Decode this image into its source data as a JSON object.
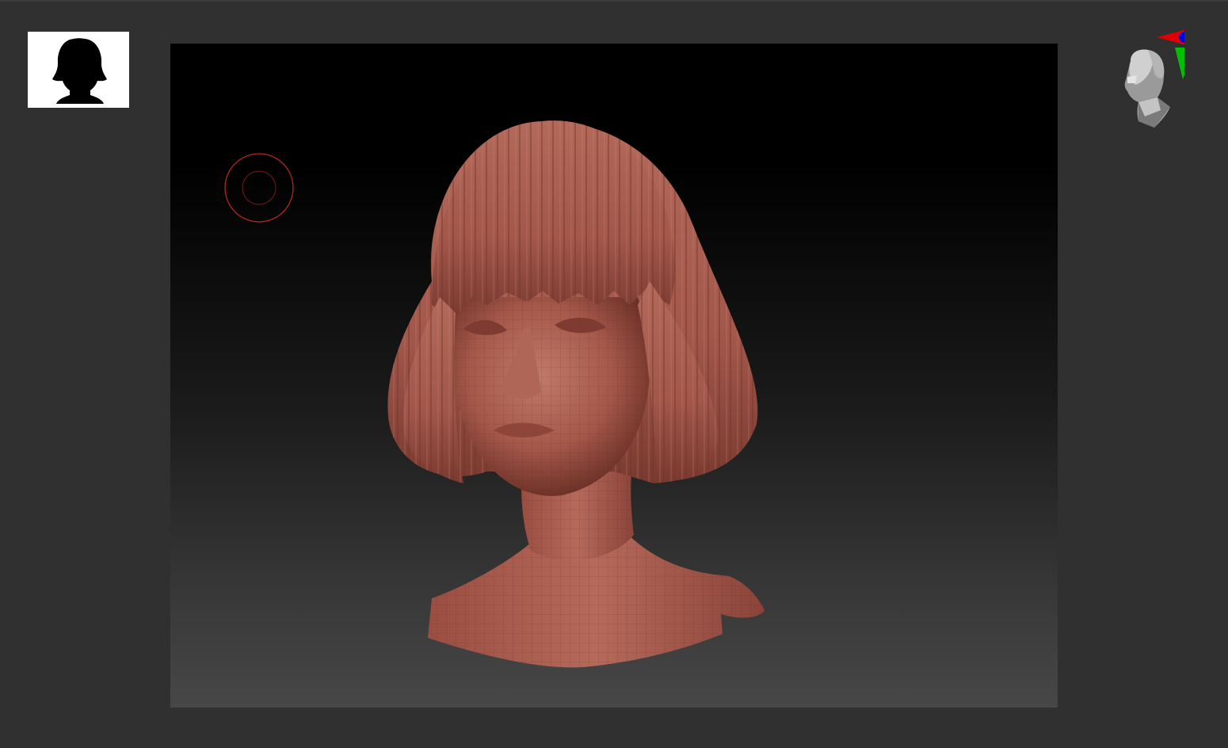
{
  "app": {
    "background_color": "#303030"
  },
  "thumbnail": {
    "icon": "female-bust-silhouette-icon",
    "background_color": "#ffffff",
    "silhouette_color": "#000000"
  },
  "viewport": {
    "background_top_color": "#000000",
    "background_bottom_color": "#474747",
    "model": {
      "icon": "female-head-bob-hair-sculpt",
      "material_color": "#a85a4c",
      "wireframe_visible": true
    },
    "brush_cursor": {
      "icon": "brush-circle-icon",
      "color": "#c0281e"
    }
  },
  "navigator": {
    "icon": "navigation-head-gizmo-icon",
    "axis_colors": {
      "x": "#e00000",
      "y": "#00c000",
      "z": "#0000e0"
    }
  }
}
